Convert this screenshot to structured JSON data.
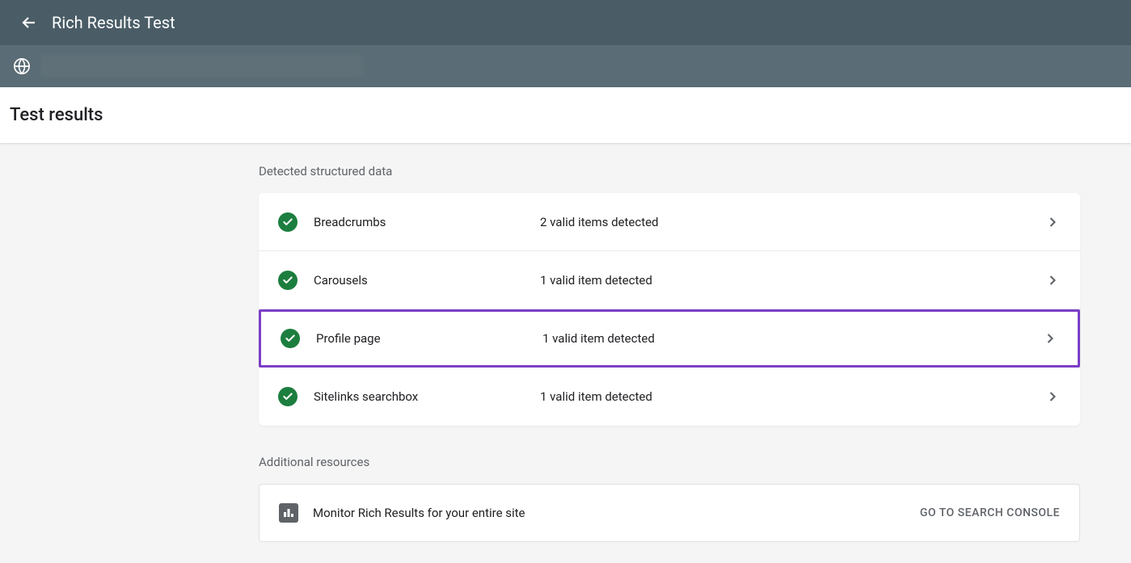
{
  "header": {
    "title": "Rich Results Test"
  },
  "results": {
    "heading": "Test results",
    "section_label": "Detected structured data",
    "items": [
      {
        "name": "Breadcrumbs",
        "status": "2 valid items detected",
        "highlighted": false
      },
      {
        "name": "Carousels",
        "status": "1 valid item detected",
        "highlighted": false
      },
      {
        "name": "Profile page",
        "status": "1 valid item detected",
        "highlighted": true
      },
      {
        "name": "Sitelinks searchbox",
        "status": "1 valid item detected",
        "highlighted": false
      }
    ]
  },
  "additional": {
    "label": "Additional resources",
    "monitor_text": "Monitor Rich Results for your entire site",
    "console_link": "GO TO SEARCH CONSOLE"
  }
}
